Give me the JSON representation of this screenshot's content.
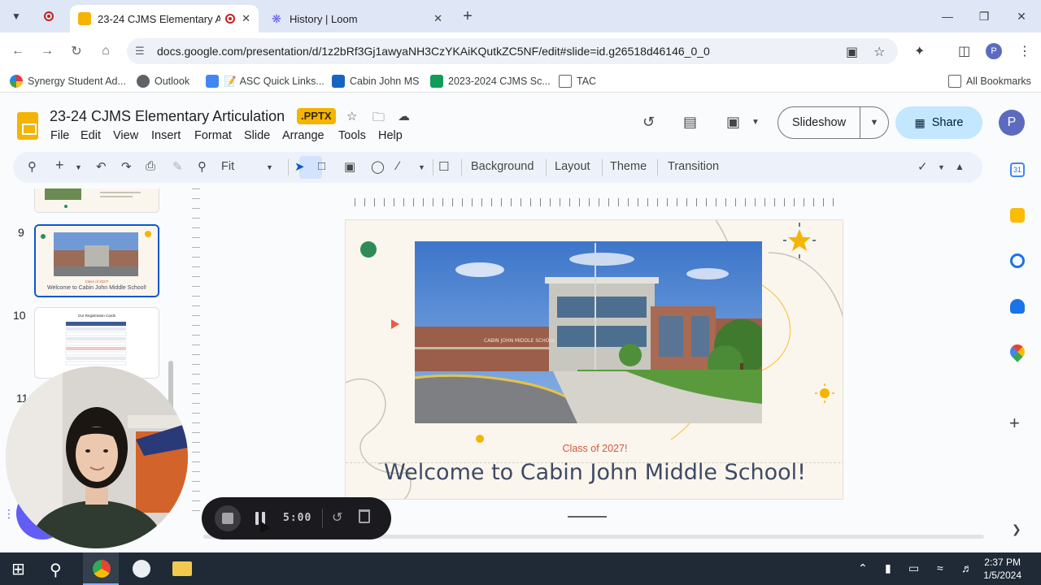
{
  "browser": {
    "tabs": [
      {
        "title": "23-24 CJMS Elementary Articulation",
        "active": true
      },
      {
        "title": "History | Loom",
        "active": false
      }
    ],
    "new_tab": "+",
    "url": "docs.google.com/presentation/d/1z2bRf3Gj1awyaNH3CzYKAiKQutkZC5NF/edit#slide=id.g26518d46146_0_0",
    "profile_initial": "P",
    "bookmarks": [
      "Synergy Student Ad...",
      "Outlook",
      "ASC Quick Links...",
      "Cabin John MS",
      "2023-2024 CJMS Sc...",
      "TAC"
    ],
    "all_bookmarks": "All Bookmarks"
  },
  "slides_app": {
    "doc_title": "23-24 CJMS Elementary Articulation",
    "format_badge": ".PPTX",
    "menu": [
      "File",
      "Edit",
      "View",
      "Insert",
      "Format",
      "Slide",
      "Arrange",
      "Tools",
      "Help"
    ],
    "slideshow_label": "Slideshow",
    "share_label": "Share",
    "avatar_initial": "P",
    "toolbar": {
      "zoom": "Fit",
      "background": "Background",
      "layout": "Layout",
      "theme": "Theme",
      "transition": "Transition"
    }
  },
  "filmstrip": {
    "slides": [
      {
        "number": "9",
        "caption_top": "Class of 2027!",
        "caption": "Welcome to Cabin John Middle School!",
        "selected": true
      },
      {
        "number": "10",
        "caption": "Our Registration Cards",
        "selected": false
      },
      {
        "number": "11",
        "caption": "",
        "selected": false
      }
    ]
  },
  "slide": {
    "photo_sign": "CABIN JOHN MIDDLE SCHOOL",
    "subtitle": "Class of 2027!",
    "title": "Welcome to Cabin John Middle School!"
  },
  "loom": {
    "timer": "5:00"
  },
  "taskbar": {
    "time": "2:37 PM",
    "date": "1/5/2024"
  },
  "colors": {
    "accent": "#0b57d0",
    "share_bg": "#c2e7ff",
    "loom_purple": "#625df5",
    "slide_title": "#3f4a63",
    "slide_subtitle": "#d1583c"
  }
}
